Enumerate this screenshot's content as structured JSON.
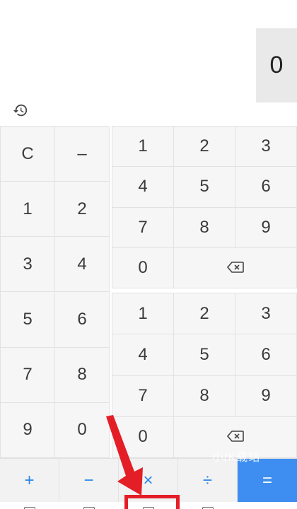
{
  "display": {
    "result": "0"
  },
  "icons": {
    "history": "history-icon",
    "backspace": "backspace-icon",
    "pointer": "red-arrow-icon"
  },
  "left_pad": {
    "keys": [
      "C",
      "–",
      "1",
      "2",
      "3",
      "4",
      "5",
      "6",
      "7",
      "8",
      "9",
      "0"
    ]
  },
  "right_pad_top": {
    "keys": [
      "1",
      "2",
      "3",
      "4",
      "5",
      "6",
      "7",
      "8",
      "9",
      "0"
    ]
  },
  "right_pad_bottom": {
    "keys": [
      "1",
      "2",
      "3",
      "4",
      "5",
      "6",
      "7",
      "8",
      "9",
      "0"
    ]
  },
  "operators": {
    "plus": "+",
    "minus": "−",
    "multiply": "×",
    "divide": "÷",
    "equals": "="
  },
  "watermark": {
    "text": "小/K载站"
  },
  "colors": {
    "accent": "#2a86e8",
    "equals_bg": "#3d8ef0",
    "highlight": "#e41e26",
    "display_bg": "#e9e9e9",
    "key_bg": "#f6f6f6"
  }
}
